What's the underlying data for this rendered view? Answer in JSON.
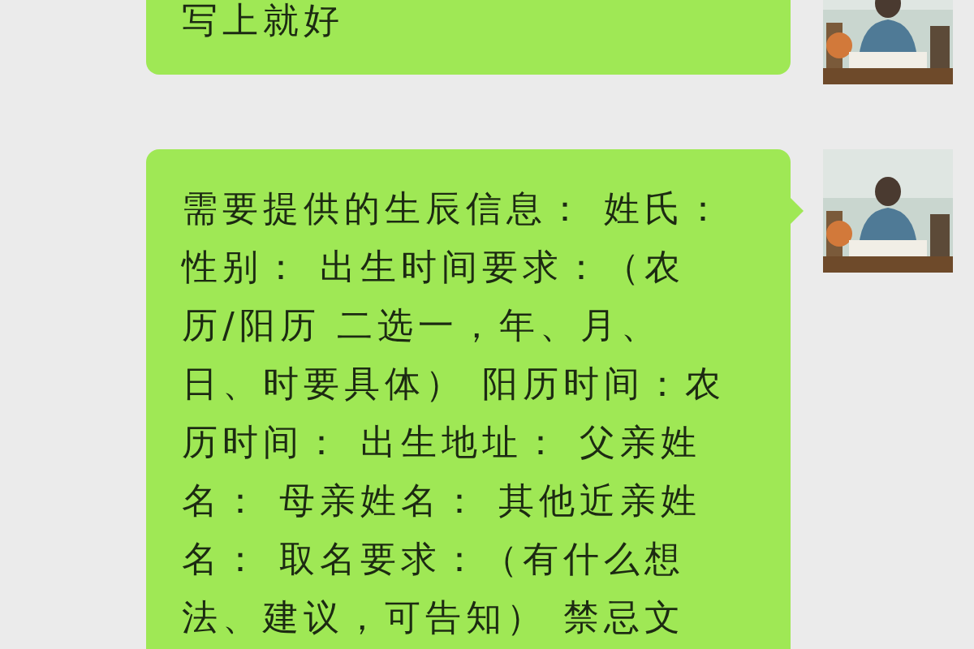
{
  "messages": [
    {
      "text": "写上就好",
      "tail": false
    },
    {
      "text": "需要提供的生辰信息： 姓氏：性别： 出生时间要求：（农历/阳历 二选一，年、月、日、时要具体） 阳历时间：农历时间： 出生地址： 父亲姓名： 母亲姓名： 其他近亲姓名： 取名要求：（有什么想法、建议，可告知） 禁忌文",
      "tail": true
    }
  ]
}
